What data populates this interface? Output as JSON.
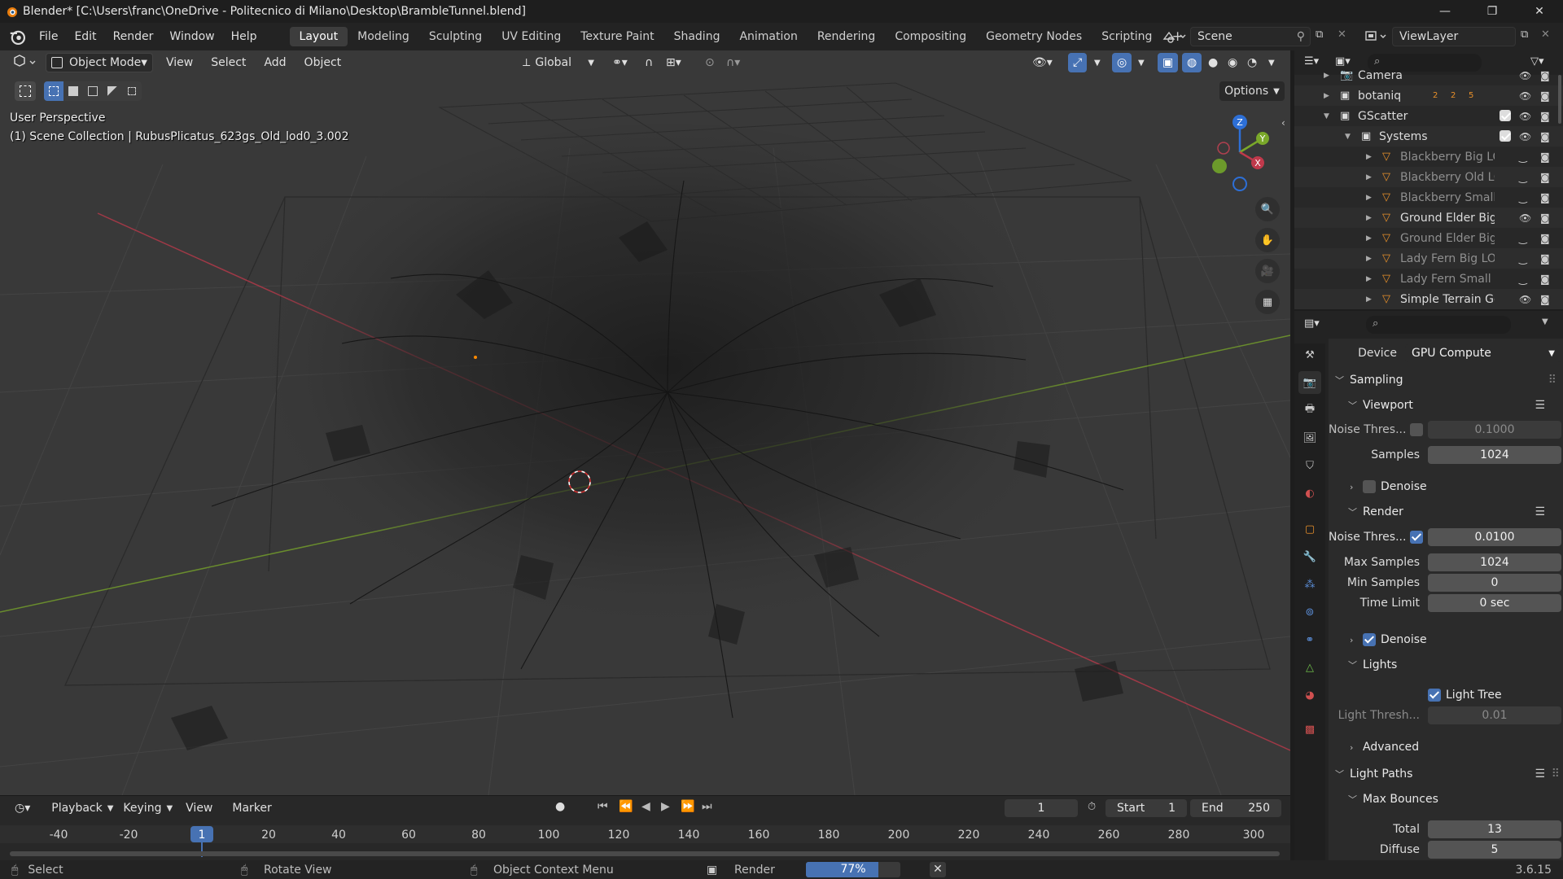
{
  "window": {
    "title": "Blender* [C:\\Users\\franc\\OneDrive - Politecnico di Milano\\Desktop\\BrambleTunnel.blend]",
    "minimize": "—",
    "maximize": "❐",
    "close": "✕"
  },
  "menu": [
    "File",
    "Edit",
    "Render",
    "Window",
    "Help"
  ],
  "workspaces": [
    "Layout",
    "Modeling",
    "Sculpting",
    "UV Editing",
    "Texture Paint",
    "Shading",
    "Animation",
    "Rendering",
    "Compositing",
    "Geometry Nodes",
    "Scripting"
  ],
  "active_workspace": "Layout",
  "add_workspace": "+",
  "scene": {
    "name": "Scene",
    "view_layer": "ViewLayer"
  },
  "viewport": {
    "mode": "Object Mode",
    "menus": [
      "View",
      "Select",
      "Add",
      "Object"
    ],
    "transform_orientation": "Global",
    "options": "Options",
    "perspective_label": "User Perspective",
    "collection_label": "(1) Scene Collection | RubusPlicatus_623gs_Old_lod0_3.002",
    "gizmo_axes": {
      "x": "X",
      "y": "Y",
      "z": "Z"
    },
    "axis_colors": {
      "x": "#c0394b",
      "y": "#7aa82a",
      "z": "#2d6fd6"
    }
  },
  "timeline": {
    "menus": [
      "Playback",
      "Keying",
      "View",
      "Marker"
    ],
    "current_frame": "1",
    "start_label": "Start",
    "start": "1",
    "end_label": "End",
    "end": "250",
    "ruler": [
      "-40",
      "-20",
      "1",
      "20",
      "40",
      "60",
      "80",
      "100",
      "120",
      "140",
      "160",
      "180",
      "200",
      "220",
      "240",
      "260",
      "280",
      "300"
    ]
  },
  "statusbar": {
    "select": "Select",
    "rotate": "Rotate View",
    "context_menu": "Object Context Menu",
    "render": "Render",
    "progress_text": "77%",
    "progress": 0.77,
    "version": "3.6.15"
  },
  "outliner": {
    "rows": [
      {
        "name": "Camera",
        "indent": 0,
        "icon": "camera"
      },
      {
        "name": "botaniq",
        "indent": 0,
        "icon": "collection"
      },
      {
        "name": "GScatter",
        "indent": 0,
        "icon": "collection"
      },
      {
        "name": "Systems",
        "indent": 1,
        "icon": "collection"
      },
      {
        "name": "Blackberry Big LO",
        "indent": 2,
        "icon": "mesh",
        "hidden": true
      },
      {
        "name": "Blackberry Old LO",
        "indent": 2,
        "icon": "mesh",
        "hidden": true
      },
      {
        "name": "Blackberry Small I",
        "indent": 2,
        "icon": "mesh",
        "hidden": true
      },
      {
        "name": "Ground Elder Big I",
        "indent": 2,
        "icon": "mesh",
        "hidden": false
      },
      {
        "name": "Ground Elder Big I",
        "indent": 2,
        "icon": "mesh",
        "hidden": true
      },
      {
        "name": "Lady Fern Big LOD",
        "indent": 2,
        "icon": "mesh",
        "hidden": true
      },
      {
        "name": "Lady Fern Small L",
        "indent": 2,
        "icon": "mesh",
        "hidden": true
      },
      {
        "name": "Simple Terrain Ge",
        "indent": 2,
        "icon": "mesh",
        "hidden": false
      }
    ],
    "botaniq_badges": [
      "2",
      "2",
      "5"
    ]
  },
  "properties": {
    "device_label": "Device",
    "device": "GPU Compute",
    "sampling": "Sampling",
    "viewport": "Viewport",
    "vp_noise_label": "Noise Thres...",
    "vp_noise": "0.1000",
    "vp_samples_label": "Samples",
    "vp_samples": "1024",
    "denoise": "Denoise",
    "render": "Render",
    "r_noise_label": "Noise Thres...",
    "r_noise": "0.0100",
    "max_samples_label": "Max Samples",
    "max_samples": "1024",
    "min_samples_label": "Min Samples",
    "min_samples": "0",
    "time_limit_label": "Time Limit",
    "time_limit": "0 sec",
    "lights": "Lights",
    "light_tree": "Light Tree",
    "light_thresh_label": "Light Thresh...",
    "light_thresh": "0.01",
    "advanced": "Advanced",
    "light_paths": "Light Paths",
    "max_bounces": "Max Bounces",
    "total_label": "Total",
    "total": "13",
    "diffuse_label": "Diffuse",
    "diffuse": "5"
  }
}
